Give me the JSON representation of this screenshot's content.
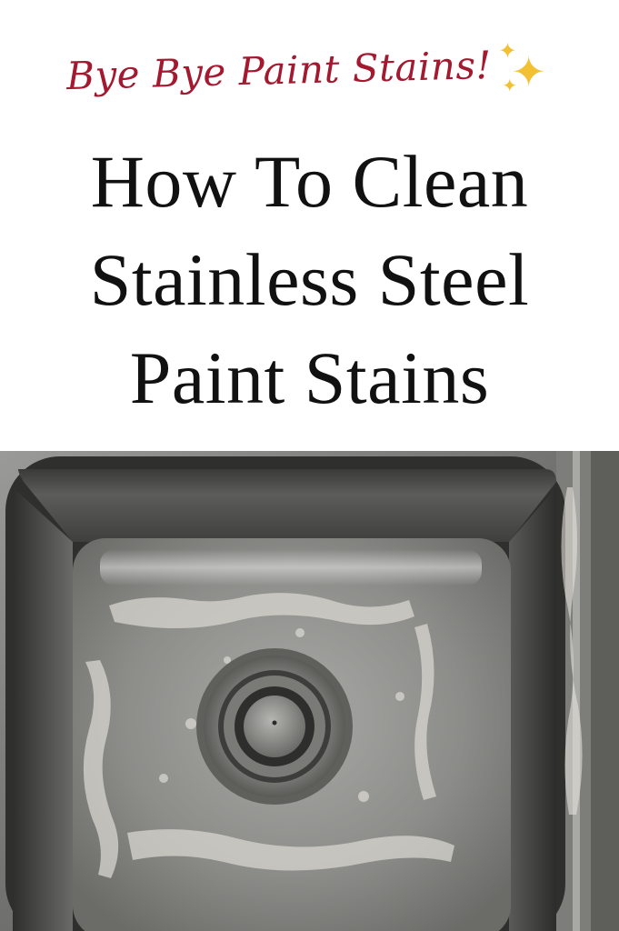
{
  "tagline": "Bye Bye Paint Stains!",
  "sparkle_icon": "sparkles-icon",
  "title_lines": [
    "How To Clean",
    "Stainless Steel",
    "Paint Stains"
  ],
  "colors": {
    "tagline": "#a3192f",
    "title": "#111111",
    "sparkles": "#f2c033",
    "background": "#ffffff"
  }
}
